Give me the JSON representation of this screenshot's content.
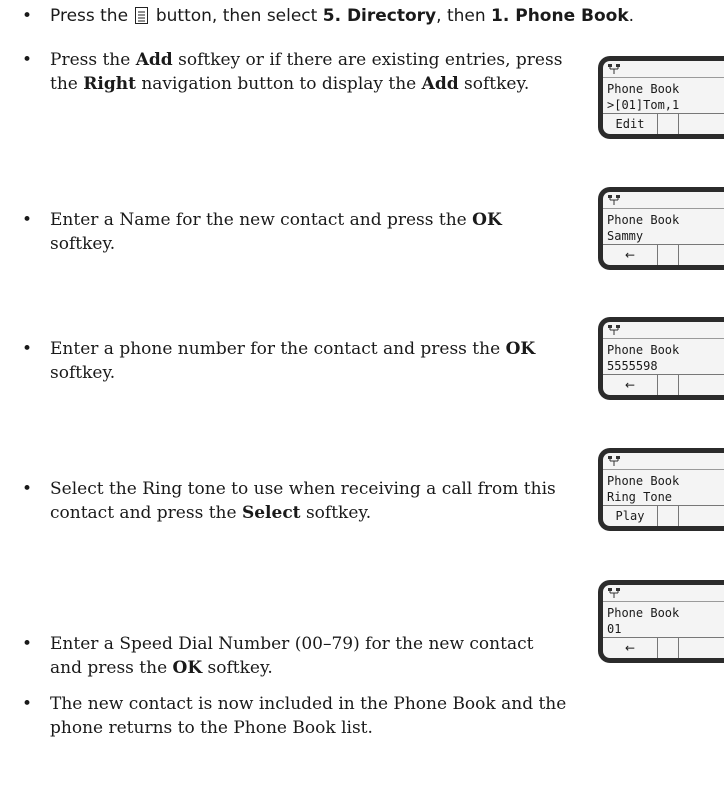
{
  "steps": [
    {
      "pre": "Press the ",
      "icon": "document-icon",
      "mid": " button, then select ",
      "b1": "5. Directory",
      "mid2": ", then ",
      "b2": "1. Phone Book",
      "post": "."
    },
    {
      "pre": "Press the ",
      "b1": "Add",
      "mid": " softkey or if there are existing entries, press the ",
      "b2": "Right",
      "mid2": " navigation button to display the ",
      "b3": "Add",
      "post": " softkey."
    },
    {
      "pre": "Enter a Name for the new contact and press the ",
      "b1": "OK",
      "post": " softkey."
    },
    {
      "pre": "Enter a phone number for the contact and press the ",
      "b1": "OK",
      "post": " softkey."
    },
    {
      "pre": "Select the Ring tone to use when receiving a call from this contact and press the ",
      "b1": "Select",
      "post": " softkey."
    },
    {
      "pre": "Enter a Speed Dial Number (00–79) for the new contact and press the ",
      "b1": "OK",
      "post": " softkey."
    },
    {
      "pre": "The new contact is now included in the Phone Book and the phone returns to the Phone Book list."
    }
  ],
  "screens": [
    {
      "line1": "Phone Book",
      "line2": ">[01]Tom,1",
      "key": "Edit"
    },
    {
      "line1": "Phone Book",
      "line2": "Sammy",
      "key": "←"
    },
    {
      "line1": "Phone Book",
      "line2": "5555598",
      "key": "←"
    },
    {
      "line1": "Phone Book",
      "line2": "Ring Tone",
      "key": "Play"
    },
    {
      "line1": "Phone Book",
      "line2": "01",
      "key": "←"
    }
  ],
  "icons": {
    "network": "network-icon"
  }
}
